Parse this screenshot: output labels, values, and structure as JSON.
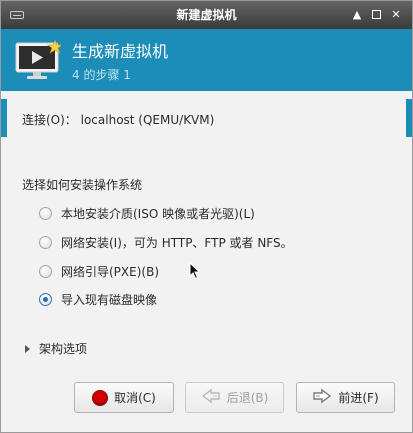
{
  "window": {
    "title": "新建虚拟机"
  },
  "banner": {
    "heading": "生成新虚拟机",
    "step": "4 的步骤 1",
    "color": "#1c8db8"
  },
  "connection": {
    "label": "连接(O)： localhost (QEMU/KVM)"
  },
  "install": {
    "section_label": "选择如何安装操作系统",
    "options": [
      {
        "label": "本地安装介质(ISO 映像或者光驱)(L)",
        "checked": false
      },
      {
        "label": "网络安装(I)，可为 HTTP、FTP 或者 NFS。",
        "checked": false
      },
      {
        "label": "网络引导(PXE)(B)",
        "checked": false
      },
      {
        "label": "导入现有磁盘映像",
        "checked": true
      }
    ]
  },
  "expander": {
    "label": "架构选项",
    "expanded": false
  },
  "buttons": {
    "cancel": "取消(C)",
    "back": "后退(B)",
    "forward": "前进(F)"
  },
  "icons": {
    "window_menu": "window-menu-icon",
    "titlebar_controls": [
      "keep-above-icon",
      "maximize-icon",
      "close-icon"
    ],
    "banner": "new-vm-monitor-icon",
    "cancel": "stop-icon",
    "back": "back-arrow-icon",
    "forward": "forward-arrow-icon"
  }
}
